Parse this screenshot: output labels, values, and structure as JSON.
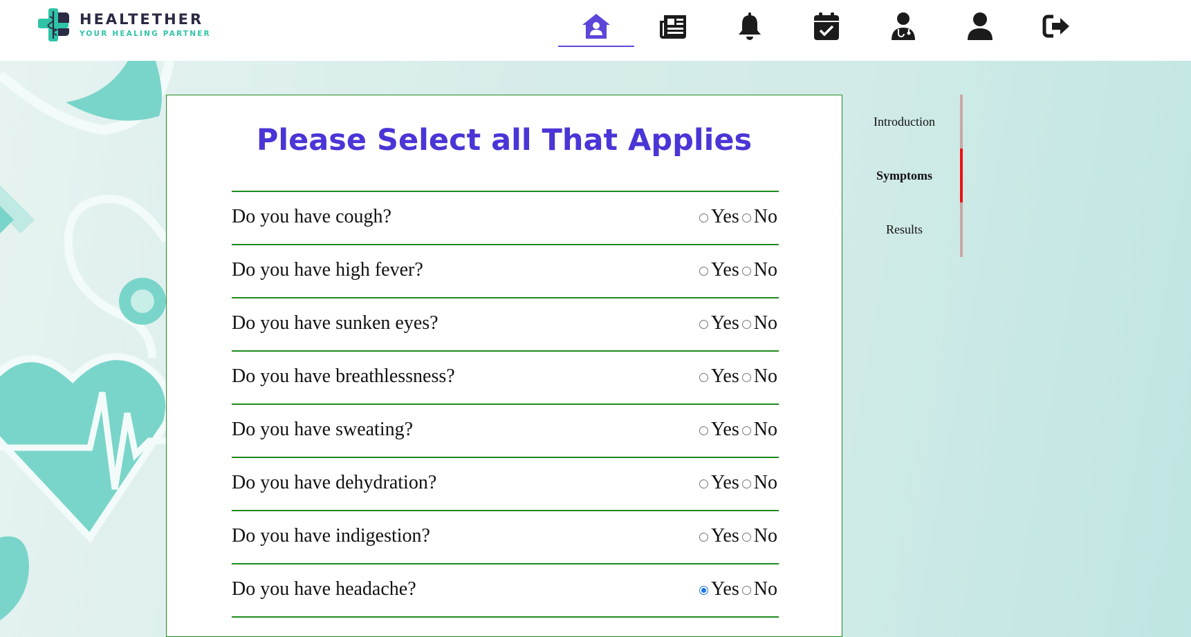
{
  "brand": {
    "name": "HEALTETHER",
    "tagline": "YOUR HEALING PARTNER",
    "colors": {
      "primary": "#2b2b45",
      "accent": "#2fc4a8"
    }
  },
  "nav": {
    "items": [
      {
        "name": "home-icon",
        "active": true
      },
      {
        "name": "newspaper-icon",
        "active": false
      },
      {
        "name": "bell-icon",
        "active": false
      },
      {
        "name": "calendar-check-icon",
        "active": false
      },
      {
        "name": "doctor-icon",
        "active": false
      },
      {
        "name": "user-icon",
        "active": false
      },
      {
        "name": "logout-icon",
        "active": false
      }
    ],
    "active_color": "#5b46d9"
  },
  "form": {
    "title": "Please Select all That Applies",
    "yes_label": "Yes",
    "no_label": "No",
    "questions": [
      {
        "text": "Do you have cough?",
        "answer": null
      },
      {
        "text": "Do you have high fever?",
        "answer": null
      },
      {
        "text": "Do you have sunken eyes?",
        "answer": null
      },
      {
        "text": "Do you have breathlessness?",
        "answer": null
      },
      {
        "text": "Do you have sweating?",
        "answer": null
      },
      {
        "text": "Do you have dehydration?",
        "answer": null
      },
      {
        "text": "Do you have indigestion?",
        "answer": null
      },
      {
        "text": "Do you have headache?",
        "answer": "Yes"
      }
    ]
  },
  "steps": {
    "items": [
      {
        "label": "Introduction",
        "active": false
      },
      {
        "label": "Symptoms",
        "active": true
      },
      {
        "label": "Results",
        "active": false
      }
    ],
    "active_color": "#ee1111",
    "inactive_color": "#c9a7a7"
  }
}
